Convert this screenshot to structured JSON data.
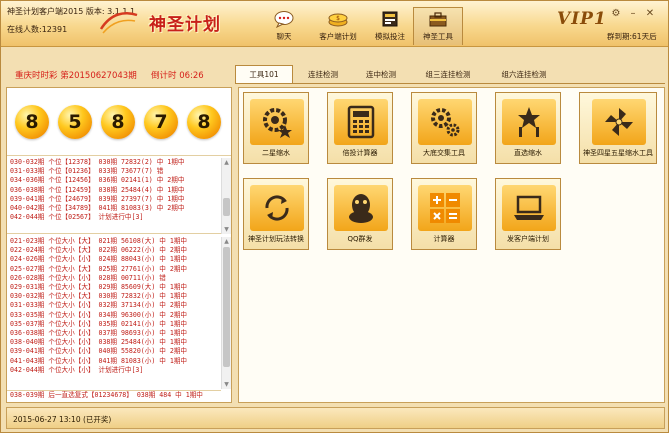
{
  "header": {
    "title": "神圣计划客户端2015  版本: 3.1.1.1",
    "online_label": "在线人数:",
    "online_count": "12391",
    "brand": "神圣计划",
    "vip": "VIP1",
    "expiry": "群到期:61天后",
    "nav": [
      {
        "label": "聊天",
        "icon": "chat-bubble-icon"
      },
      {
        "label": "客户端计划",
        "icon": "coin-plan-icon"
      },
      {
        "label": "模拟投注",
        "icon": "betting-slip-icon"
      },
      {
        "label": "神圣工具",
        "icon": "toolbox-icon",
        "active": true
      }
    ]
  },
  "infobar": {
    "issue": "重庆时时彩 第20150627043期",
    "countdown": "倒计时 06:26"
  },
  "tabs": [
    "工具101",
    "连挂检测",
    "连中检测",
    "组三连挂检测",
    "组六连挂检测"
  ],
  "balls": [
    "8",
    "5",
    "8",
    "7",
    "8"
  ],
  "log_a": [
    "030-032期 个位【12378】 030期 72832(2) 中 1期中",
    "031-033期 个位【01236】 033期 73677(7) 错",
    "034-036期 个位【12456】 036期 02141(1) 中 2期中",
    "036-038期 个位【12459】 038期 25484(4) 中 1期中",
    "039-041期 个位【24679】 039期 27397(7) 中 1期中",
    "040-042期 个位【34789】 041期 81083(3) 中 2期中",
    "042-044期 个位【02567】 计划进行中[3]"
  ],
  "log_b": [
    "021-023期 个位大小【大】 021期 56108(大) 中 1期中",
    "022-024期 个位大小【大】 022期 06222(小) 中 2期中",
    "024-026期 个位大小【小】 024期 88043(小) 中 1期中",
    "025-027期 个位大小【大】 025期 27761(小) 中 2期中",
    "026-028期 个位大小【小】 028期 00711(小) 错",
    "029-031期 个位大小【大】 029期 85609(大) 中 1期中",
    "030-032期 个位大小【大】 030期 72832(小) 中 1期中",
    "031-033期 个位大小【小】 032期 37134(小) 中 2期中",
    "033-035期 个位大小【小】 034期 96300(小) 中 2期中",
    "035-037期 个位大小【小】 035期 02141(小) 中 1期中",
    "036-038期 个位大小【小】 037期 98693(小) 中 1期中",
    "038-040期 个位大小【小】 038期 25484(小) 中 1期中",
    "039-041期 个位大小【小】 040期 55820(小) 中 2期中",
    "041-043期 个位大小【小】 041期 81083(小) 中 1期中",
    "042-044期 个位大小【小】 计划进行中[3]"
  ],
  "log_c": [
    "038-039期 后一直选复式【01234678】 038期 484 中 1期中"
  ],
  "tools": [
    {
      "label": "二星缩水",
      "icon": "gear-star-icon"
    },
    {
      "label": "倍投计算器",
      "icon": "calculator-icon"
    },
    {
      "label": "大底交集工具",
      "icon": "gears-icon"
    },
    {
      "label": "直选缩水",
      "icon": "star-fork-icon"
    },
    {
      "label": "神圣四星五星缩水工具",
      "icon": "pinwheel-icon"
    },
    {
      "label": "神圣计划玩法转换",
      "icon": "cycle-arrows-icon"
    },
    {
      "label": "QQ群发",
      "icon": "qq-penguin-icon"
    },
    {
      "label": "计算器",
      "icon": "math-ops-icon"
    },
    {
      "label": "发客户端计划",
      "icon": "laptop-icon"
    }
  ],
  "status": "2015-06-27 13:10 (已开奖)",
  "colors": {
    "accent_red": "#d6201a",
    "gold": "#f2a519",
    "border": "#b98a3e"
  }
}
